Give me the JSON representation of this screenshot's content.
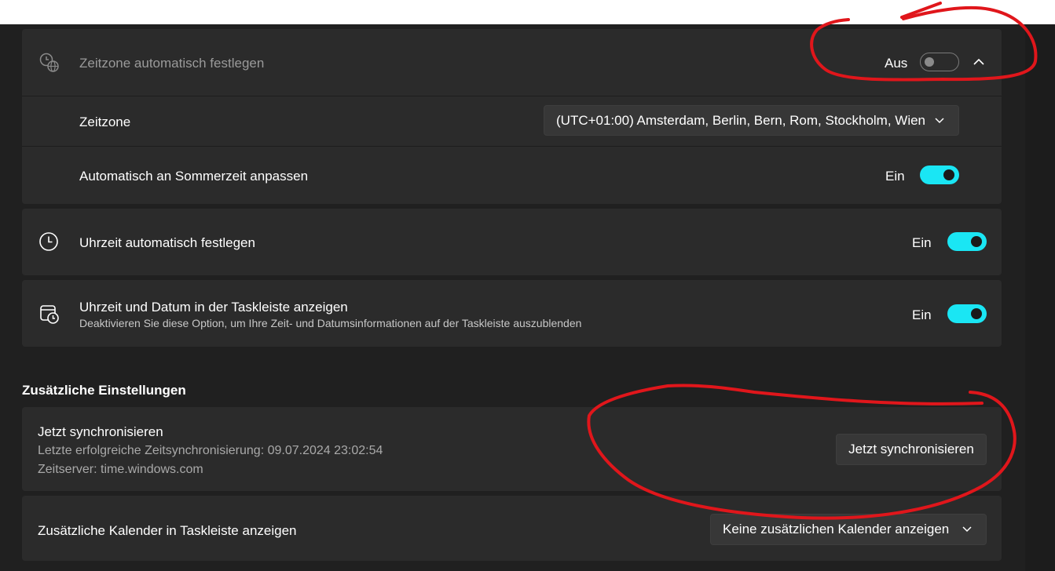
{
  "timezone_auto": {
    "label": "Zeitzone automatisch festlegen",
    "state": "Aus"
  },
  "timezone": {
    "label": "Zeitzone",
    "value": "(UTC+01:00) Amsterdam, Berlin, Bern, Rom, Stockholm, Wien"
  },
  "dst": {
    "label": "Automatisch an Sommerzeit anpassen",
    "state": "Ein"
  },
  "time_auto": {
    "label": "Uhrzeit automatisch festlegen",
    "state": "Ein"
  },
  "taskbar_clock": {
    "label": "Uhrzeit und Datum in der Taskleiste anzeigen",
    "description": "Deaktivieren Sie diese Option, um Ihre Zeit- und Datumsinformationen auf der Taskleiste auszublenden",
    "state": "Ein"
  },
  "additional": {
    "title": "Zusätzliche Einstellungen"
  },
  "sync": {
    "label": "Jetzt synchronisieren",
    "last_sync": "Letzte erfolgreiche Zeitsynchronisierung: 09.07.2024 23:02:54",
    "server": "Zeitserver: time.windows.com",
    "button": "Jetzt synchronisieren"
  },
  "calendar": {
    "label": "Zusätzliche Kalender in Taskleiste anzeigen",
    "value": "Keine zusätzlichen Kalender anzeigen"
  },
  "colors": {
    "accent": "#1ae6f4",
    "annotation": "#e0161b",
    "card": "#2b2b2b",
    "background": "#202020"
  },
  "icons": [
    "globe-clock-icon",
    "chevron-up-icon",
    "chevron-down-icon",
    "clock-icon",
    "calendar-clock-icon"
  ]
}
